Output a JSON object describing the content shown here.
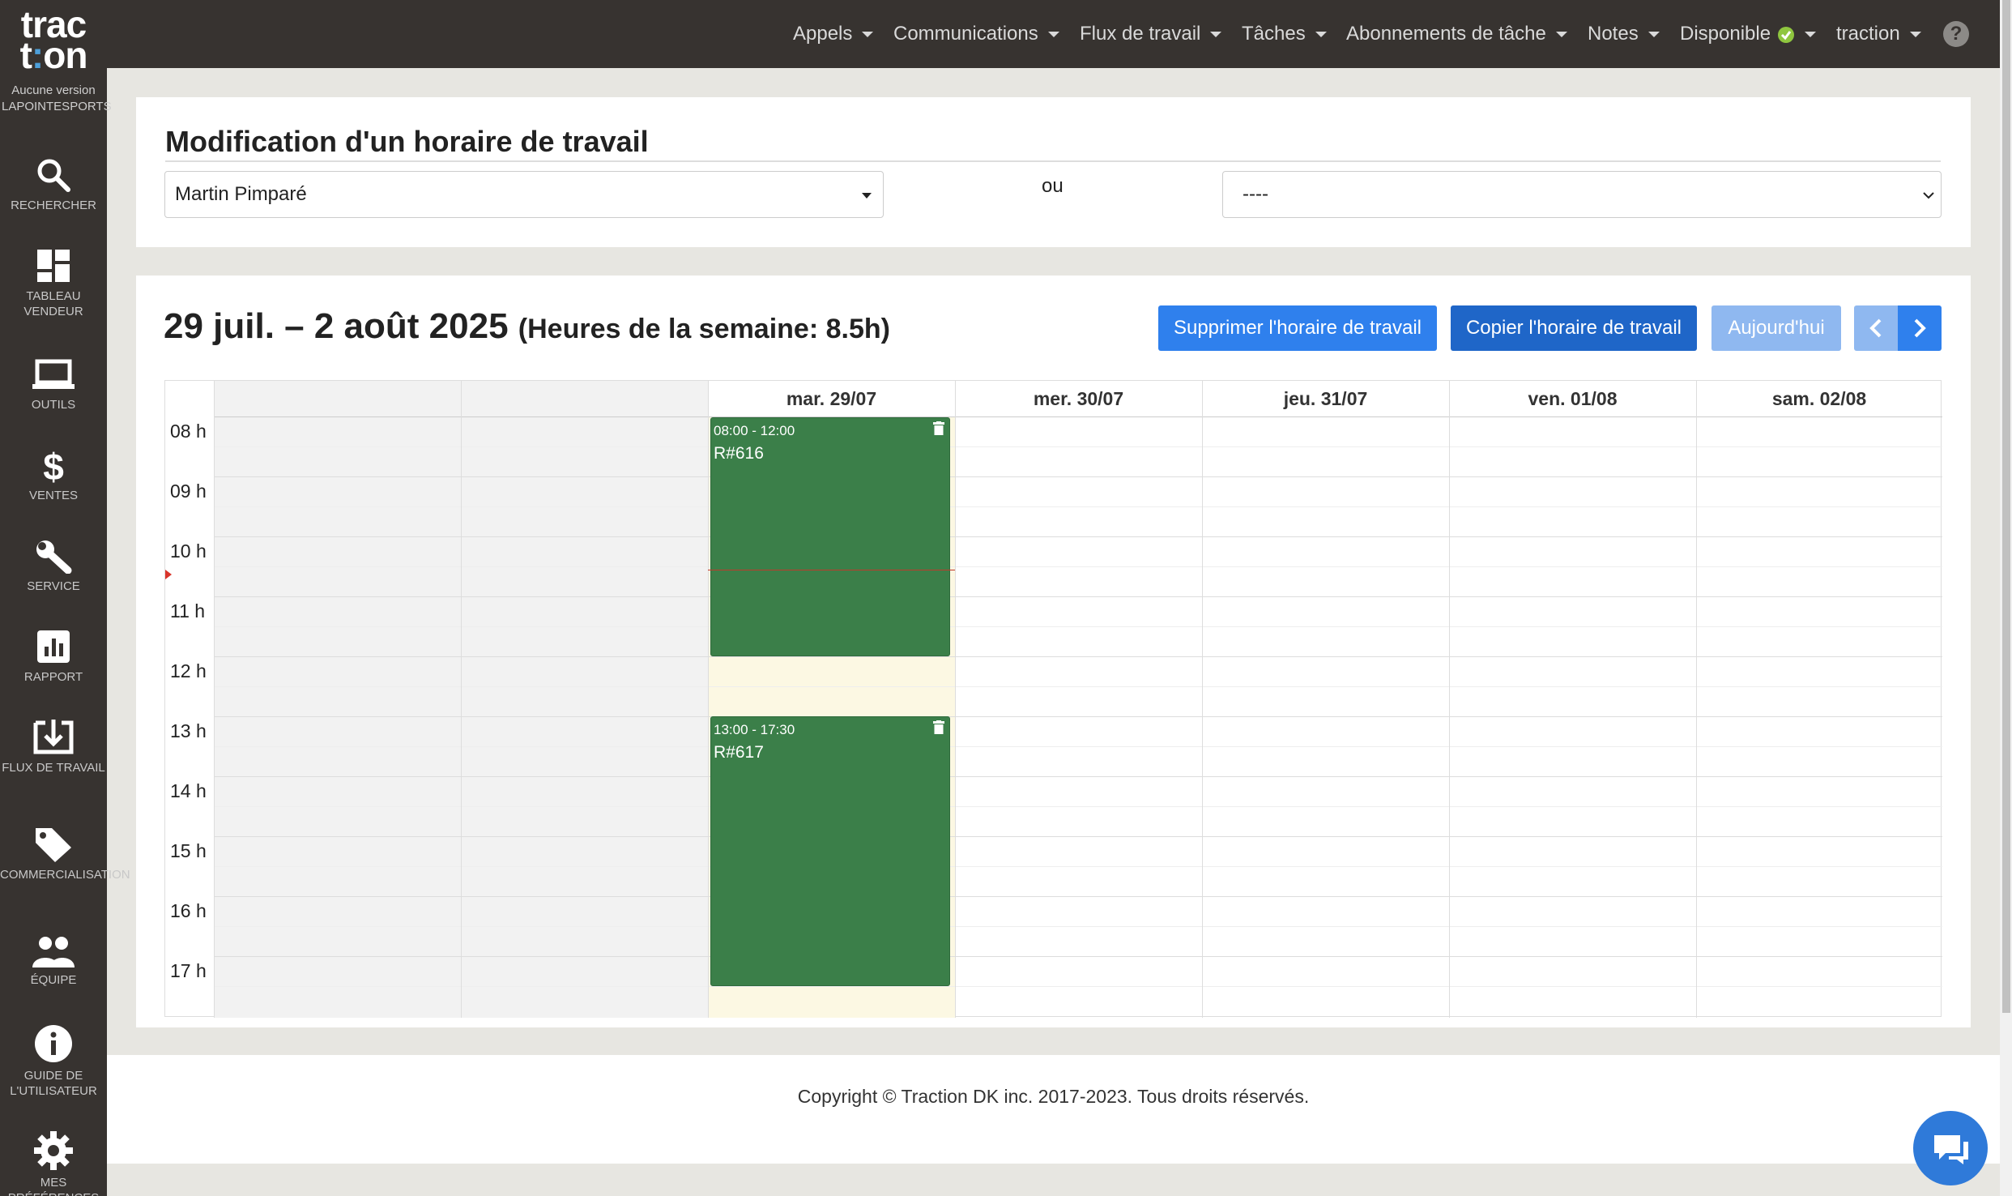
{
  "sidebar": {
    "logo_line1": "trac",
    "logo_line2_a": "t",
    "logo_line2_dot": ":",
    "logo_line2_b": "on",
    "version": "Aucune version LAPOINTESPORTS",
    "items": [
      {
        "icon": "search-icon",
        "label": "RECHERCHER"
      },
      {
        "icon": "dashboard-icon",
        "label": "TABLEAU VENDEUR"
      },
      {
        "icon": "laptop-icon",
        "label": "OUTILS"
      },
      {
        "icon": "dollar-icon",
        "label": "VENTES"
      },
      {
        "icon": "wrench-icon",
        "label": "SERVICE"
      },
      {
        "icon": "report-icon",
        "label": "RAPPORT"
      },
      {
        "icon": "download-icon",
        "label": "FLUX DE TRAVAIL"
      },
      {
        "icon": "tag-icon",
        "label": "COMMERCIALISATION"
      },
      {
        "icon": "team-icon",
        "label": "ÉQUIPE"
      },
      {
        "icon": "info-icon",
        "label": "GUIDE DE L'UTILISATEUR"
      },
      {
        "icon": "gear-icon",
        "label": "MES PRÉFÉRENCES"
      }
    ]
  },
  "topnav": {
    "items": [
      "Appels",
      "Communications",
      "Flux de travail",
      "Tâches",
      "Abonnements de tâche",
      "Notes"
    ],
    "status": "Disponible",
    "user": "traction",
    "help": "?"
  },
  "schedule_form": {
    "title": "Modification d'un horaire de travail",
    "employee_value": "Martin Pimparé",
    "or_label": "ou",
    "second_value": "----"
  },
  "calendar": {
    "range": "29 juil. – 2 août 2025",
    "week_hours": "(Heures de la semaine: 8.5h)",
    "buttons": {
      "delete": "Supprimer l'horaire de travail",
      "copy": "Copier l'horaire de travail",
      "today": "Aujourd'hui"
    },
    "columns": [
      "",
      "",
      "mar. 29/07",
      "mer. 30/07",
      "jeu. 31/07",
      "ven. 01/08",
      "sam. 02/08"
    ],
    "hours": [
      "08 h",
      "09 h",
      "10 h",
      "11 h",
      "12 h",
      "13 h",
      "14 h",
      "15 h",
      "16 h",
      "17 h"
    ],
    "events": [
      {
        "time": "08:00 - 12:00",
        "title": "R#616",
        "day": "mar. 29/07"
      },
      {
        "time": "13:00 - 17:30",
        "title": "R#617",
        "day": "mar. 29/07"
      }
    ],
    "colors": {
      "event": "#3b7f49",
      "today_bg": "#fcf8e3",
      "primary": "#2f80ed",
      "dark_primary": "#1f66c8",
      "disabled": "#8fb8f0"
    }
  },
  "footer": {
    "copyright": "Copyright © Traction DK inc. 2017-2023. Tous droits réservés."
  }
}
